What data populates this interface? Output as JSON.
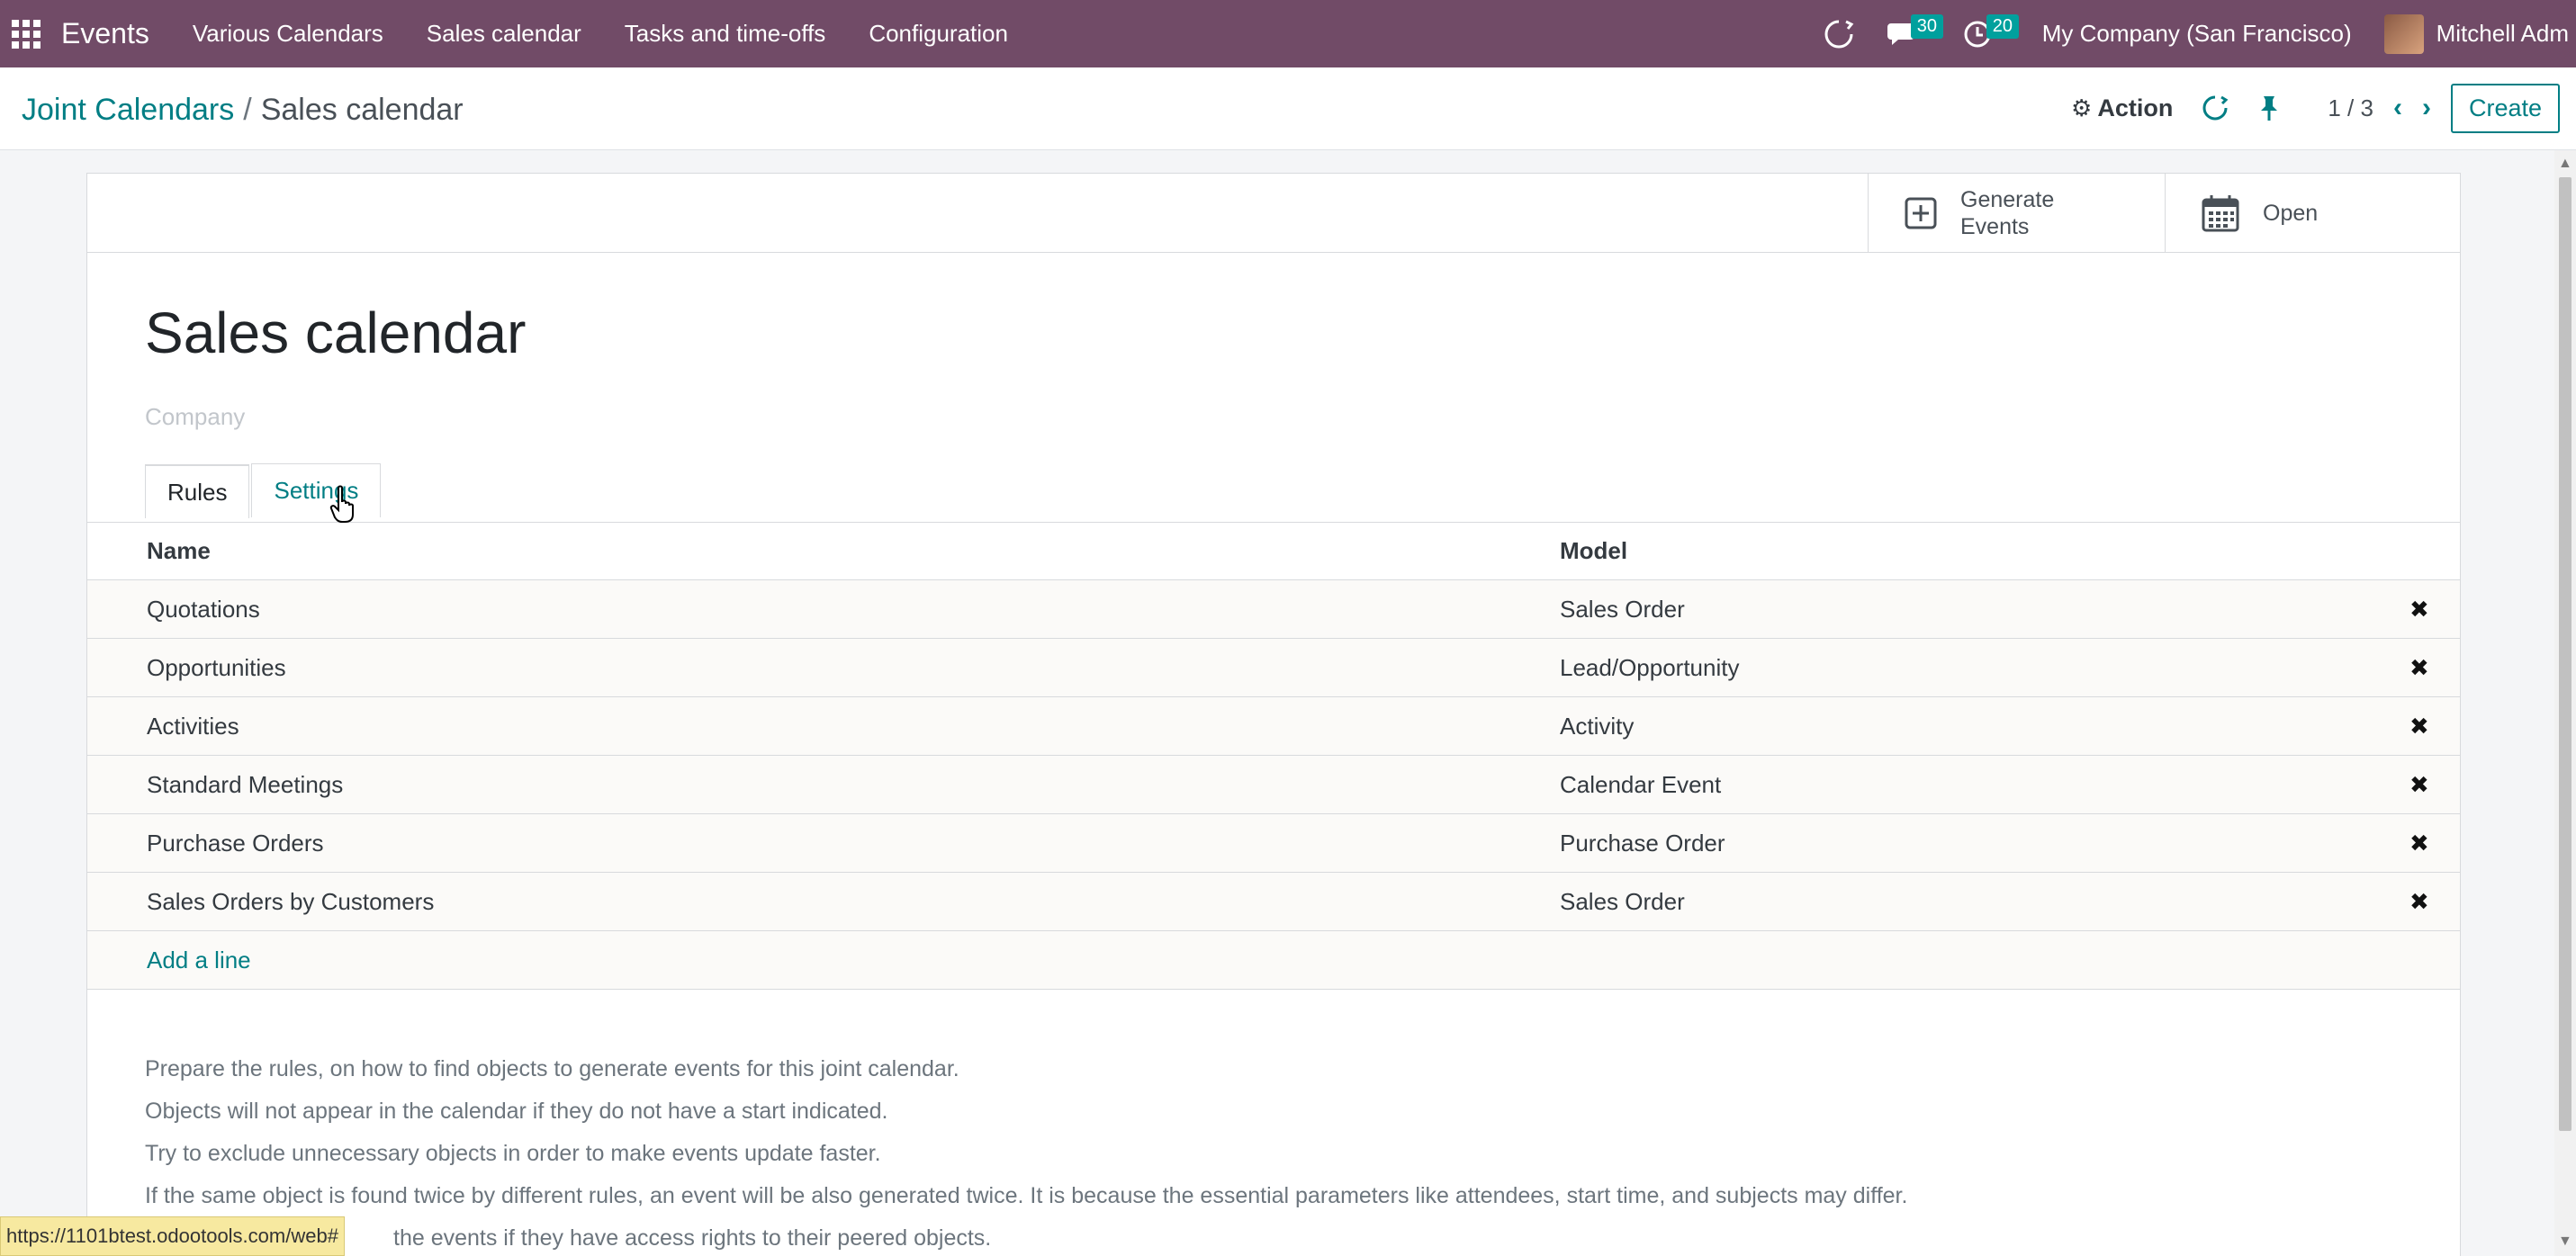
{
  "topnav": {
    "app_name": "Events",
    "menu": [
      "Various Calendars",
      "Sales calendar",
      "Tasks and time-offs",
      "Configuration"
    ],
    "messages_count": "30",
    "activities_count": "20",
    "company": "My Company (San Francisco)",
    "user": "Mitchell Adm"
  },
  "control": {
    "breadcrumb_parent": "Joint Calendars",
    "breadcrumb_sep": "/",
    "breadcrumb_current": "Sales calendar",
    "action_label": "Action",
    "pager": "1 / 3",
    "create_label": "Create"
  },
  "buttons": {
    "generate_line1": "Generate",
    "generate_line2": "Events",
    "open_label": "Open"
  },
  "record": {
    "title": "Sales calendar",
    "company_placeholder": "Company"
  },
  "tabs": [
    "Rules",
    "Settings"
  ],
  "rules": {
    "headers": [
      "Name",
      "Model"
    ],
    "rows": [
      {
        "name": "Quotations",
        "model": "Sales Order"
      },
      {
        "name": "Opportunities",
        "model": "Lead/Opportunity"
      },
      {
        "name": "Activities",
        "model": "Activity"
      },
      {
        "name": "Standard Meetings",
        "model": "Calendar Event"
      },
      {
        "name": "Purchase Orders",
        "model": "Purchase Order"
      },
      {
        "name": "Sales Orders by Customers",
        "model": "Sales Order"
      }
    ],
    "add_line": "Add a line",
    "delete_glyph": "✖"
  },
  "help": [
    "Prepare the rules, on how to find objects to generate events for this joint calendar.",
    "Objects will not appear in the calendar if they do not have a start indicated.",
    "Try to exclude unnecessary objects in order to make events update faster.",
    "If the same object is found twice by different rules, an event will be also generated twice. It is because the essential parameters like attendees, start time, and subjects may differ.",
    "the events if they have access rights to their peered objects."
  ],
  "status_url": "https://1101btest.odootools.com/web#",
  "colors": {
    "navbar": "#714b67",
    "accent": "#017e84",
    "badge": "#00a09d"
  }
}
